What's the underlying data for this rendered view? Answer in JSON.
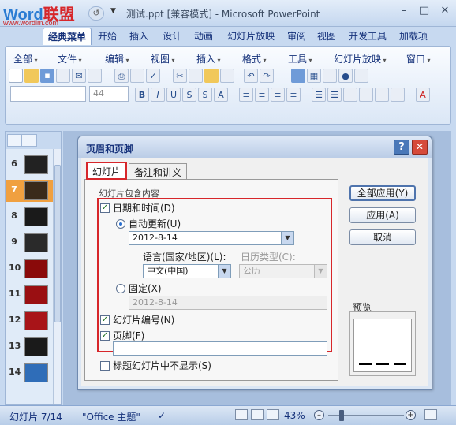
{
  "window": {
    "logo_en": "Word",
    "logo_cn": "联盟",
    "logo_url": "www.wordlm.com",
    "title": "测试.ppt [兼容模式] - Microsoft PowerPoint"
  },
  "ribbon_tabs": [
    "经典菜单",
    "开始",
    "插入",
    "设计",
    "动画",
    "幻灯片放映",
    "审阅",
    "视图",
    "开发工具",
    "加载项"
  ],
  "menu_items": [
    "全部",
    "文件",
    "编辑",
    "视图",
    "插入",
    "格式",
    "工具",
    "幻灯片放映",
    "窗口"
  ],
  "font_size": "44",
  "slides": [
    {
      "num": "6",
      "color": "#222222"
    },
    {
      "num": "7",
      "color": "#3a2a1a",
      "selected": true
    },
    {
      "num": "8",
      "color": "#1a1a1a"
    },
    {
      "num": "9",
      "color": "#2a2a2a"
    },
    {
      "num": "10",
      "color": "#8a0a0a"
    },
    {
      "num": "11",
      "color": "#9a0f12"
    },
    {
      "num": "12",
      "color": "#a81418"
    },
    {
      "num": "13",
      "color": "#1a1a1a"
    },
    {
      "num": "14",
      "color": "#2f6db8"
    }
  ],
  "dialog": {
    "title": "页眉和页脚",
    "tab_slide": "幻灯片",
    "tab_notes": "备注和讲义",
    "group_label": "幻灯片包含内容",
    "date_time": "日期和时间(D)",
    "auto_update": "自动更新(U)",
    "auto_date": "2012-8-14",
    "language_label": "语言(国家/地区)(L):",
    "language_value": "中文(中国)",
    "calendar_label": "日历类型(C):",
    "calendar_value": "公历",
    "fixed": "固定(X)",
    "fixed_value": "2012-8-14",
    "slide_number": "幻灯片编号(N)",
    "footer": "页脚(F)",
    "hide_on_title": "标题幻灯片中不显示(S)",
    "btn_apply_all": "全部应用(Y)",
    "btn_apply": "应用(A)",
    "btn_cancel": "取消",
    "preview": "预览"
  },
  "status": {
    "slide_info": "幻灯片 7/14",
    "theme": "\"Office 主题\"",
    "zoom": "43%"
  }
}
